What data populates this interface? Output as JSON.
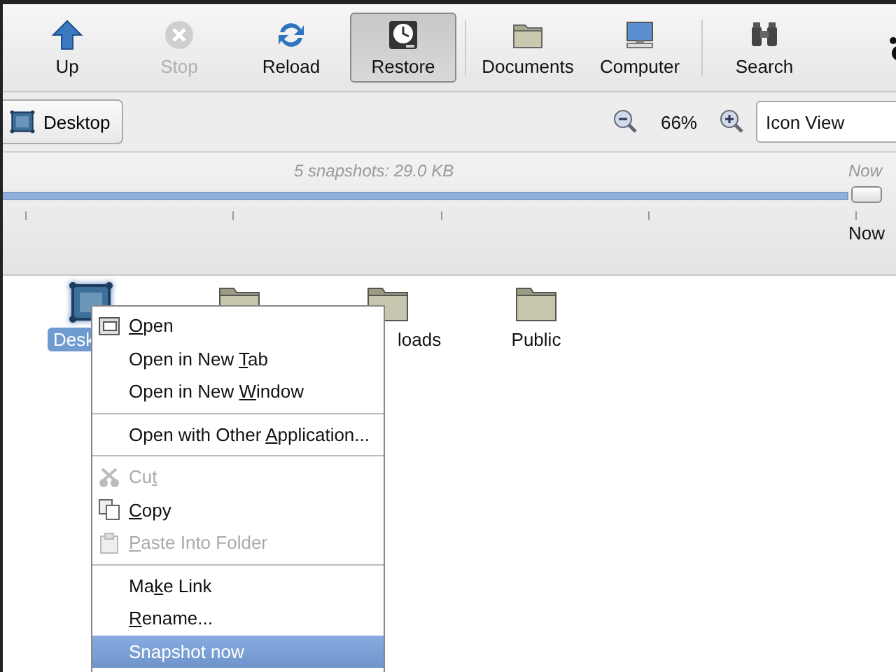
{
  "toolbar": [
    {
      "kind": "up",
      "label": "Up",
      "disabled": false,
      "pressed": false
    },
    {
      "kind": "stop",
      "label": "Stop",
      "disabled": true,
      "pressed": false
    },
    {
      "kind": "reload",
      "label": "Reload",
      "disabled": false,
      "pressed": false
    },
    {
      "kind": "restore",
      "label": "Restore",
      "disabled": false,
      "pressed": true
    },
    {
      "kind": "separator"
    },
    {
      "kind": "folder",
      "label": "Documents",
      "disabled": false,
      "pressed": false
    },
    {
      "kind": "computer",
      "label": "Computer",
      "disabled": false,
      "pressed": false
    },
    {
      "kind": "separator"
    },
    {
      "kind": "search",
      "label": "Search",
      "disabled": false,
      "pressed": false
    },
    {
      "kind": "paw"
    }
  ],
  "location": {
    "label": "Desktop",
    "zoom": "66%",
    "view": "Icon View"
  },
  "timeline": {
    "summary": "5 snapshots: 29.0 KB",
    "end_caption": "Now",
    "level": 1.0,
    "thumb_label": "Now"
  },
  "files": [
    {
      "kind": "desktop",
      "label": "Desk",
      "selected": true
    },
    {
      "kind": "folder",
      "selected": false
    },
    {
      "kind": "folder",
      "label": "loads",
      "selected": false
    },
    {
      "kind": "folder",
      "label": "Public",
      "selected": false
    }
  ],
  "context_menu": [
    {
      "kind": "open",
      "key": "O",
      "after": "pen",
      "disabled": false,
      "selected": false
    },
    {
      "kind": "item",
      "before": "Open in New ",
      "key": "T",
      "after": "ab",
      "disabled": false,
      "selected": false
    },
    {
      "kind": "item",
      "before": "Open in New ",
      "key": "W",
      "after": "indow",
      "disabled": false,
      "selected": false
    },
    {
      "kind": "separator"
    },
    {
      "kind": "item",
      "before": "Open with Other ",
      "key": "A",
      "after": "pplication...",
      "disabled": false,
      "selected": false
    },
    {
      "kind": "separator"
    },
    {
      "kind": "cut",
      "before": "Cu",
      "key": "t",
      "disabled": true,
      "selected": false
    },
    {
      "kind": "copy",
      "key": "C",
      "after": "opy",
      "disabled": false,
      "selected": false
    },
    {
      "kind": "paste",
      "key": "P",
      "after": "aste Into Folder",
      "disabled": true,
      "selected": false
    },
    {
      "kind": "separator"
    },
    {
      "kind": "item",
      "before": "Ma",
      "key": "k",
      "after": "e Link",
      "disabled": false,
      "selected": false
    },
    {
      "kind": "item",
      "key": "R",
      "after": "ename...",
      "disabled": false,
      "selected": false
    },
    {
      "kind": "item",
      "before": "Snapshot now",
      "disabled": false,
      "selected": true
    }
  ]
}
